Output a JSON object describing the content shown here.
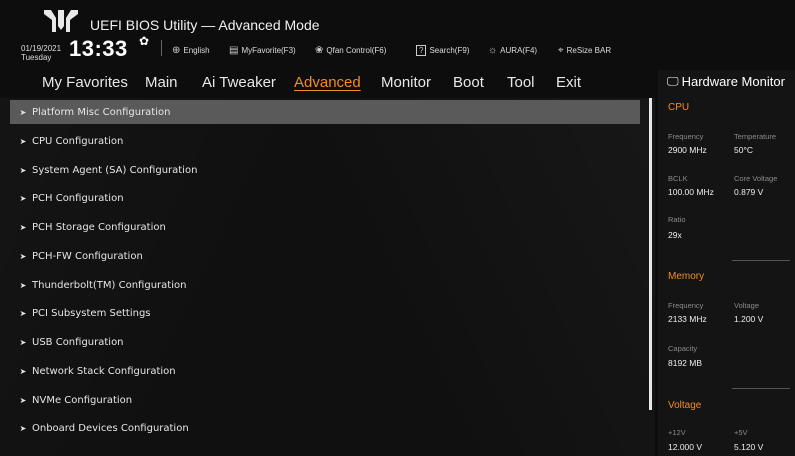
{
  "header": {
    "title": "UEFI BIOS Utility — Advanced Mode",
    "date": "01/19/2021",
    "day": "Tuesday",
    "time": "13:33",
    "tools": [
      {
        "icon": "globe-icon",
        "label": "English"
      },
      {
        "icon": "favorites-icon",
        "label": "MyFavorite(F3)"
      },
      {
        "icon": "fan-icon",
        "label": "Qfan Control(F6)"
      },
      {
        "icon": "help-icon",
        "label": "Search(F9)"
      },
      {
        "icon": "aura-icon",
        "label": "AURA(F4)"
      },
      {
        "icon": "resize-bar-icon",
        "label": "ReSize BAR"
      }
    ]
  },
  "nav": {
    "tabs": [
      "My Favorites",
      "Main",
      "Ai Tweaker",
      "Advanced",
      "Monitor",
      "Boot",
      "Tool",
      "Exit"
    ],
    "active": "Advanced"
  },
  "menu": {
    "items": [
      "Platform Misc Configuration",
      "CPU Configuration",
      "System Agent (SA) Configuration",
      "PCH Configuration",
      "PCH Storage Configuration",
      "PCH-FW Configuration",
      "Thunderbolt(TM) Configuration",
      "PCI Subsystem Settings",
      "USB Configuration",
      "Network Stack Configuration",
      "NVMe Configuration",
      "Onboard Devices Configuration"
    ],
    "selected_index": 0
  },
  "hw_monitor": {
    "title": "Hardware Monitor",
    "cpu": {
      "heading": "CPU",
      "frequency_label": "Frequency",
      "frequency": "2900 MHz",
      "temperature_label": "Temperature",
      "temperature": "50°C",
      "bclk_label": "BCLK",
      "bclk": "100.00 MHz",
      "core_voltage_label": "Core Voltage",
      "core_voltage": "0.879 V",
      "ratio_label": "Ratio",
      "ratio": "29x"
    },
    "memory": {
      "heading": "Memory",
      "frequency_label": "Frequency",
      "frequency": "2133 MHz",
      "voltage_label": "Voltage",
      "voltage": "1.200 V",
      "capacity_label": "Capacity",
      "capacity": "8192 MB"
    },
    "voltage": {
      "heading": "Voltage",
      "v12_label": "+12V",
      "v12": "12.000 V",
      "v5_label": "+5V",
      "v5": "5.120 V"
    }
  },
  "colors": {
    "accent": "#f38c20",
    "selected_row": "#5a5a5a",
    "background": "#0d0d0d"
  }
}
